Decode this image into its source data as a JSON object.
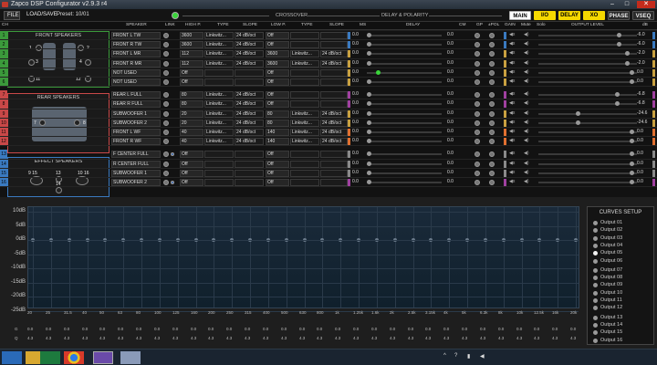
{
  "window": {
    "title": "Zapco DSP Configurator v2.9.3 r4",
    "buttons": [
      "–",
      "□",
      "✕"
    ]
  },
  "toolbar": {
    "file": "FILE",
    "load_save": "LOAD/SAVE",
    "preset": "Preset: 10/01",
    "crossover": "CROSSOVER",
    "delay_polarity": "DELAY & POLARITY",
    "tabs": [
      "MAIN",
      "I/O",
      "DELAY",
      "XO",
      "PHASE",
      "VSEQ"
    ]
  },
  "columns": {
    "ch": "CH",
    "speaker": "SPEAKER",
    "link": "LINK",
    "high_p": "HIGH P.",
    "type": "TYPE",
    "slope": "SLOPE",
    "low_p": "LOW P.",
    "type2": "TYPE",
    "slope2": "SLOPE",
    "ms": "MS",
    "delay": "DELAY",
    "cm": "CM",
    "gp": "GP",
    "pol": "±POL",
    "gain": "GAIN",
    "mute": "Mute",
    "solo": "Solo",
    "output_level": "OUTPUT LEVEL",
    "db": "dB"
  },
  "speaker_panels": {
    "front": {
      "title": "FRONT SPEAKERS",
      "nums": [
        "1",
        "2",
        "3",
        "4",
        "11",
        "12"
      ]
    },
    "rear": {
      "title": "REAR SPEAKERS",
      "nums": [
        "7",
        "8"
      ]
    },
    "effect": {
      "title": "EFFECT SPEAKERS",
      "nums": [
        "9 15",
        "13",
        "10 16",
        "14"
      ]
    }
  },
  "rows": [
    {
      "ch": "1",
      "speaker": "FRONT L TW",
      "hp": "3600",
      "htype": "Linkwitz...",
      "hslope": "24 dB/oct",
      "lp": "Off",
      "ltype": "",
      "lslope": "",
      "ms": "0.0",
      "delay": "0.0",
      "db": "-6.0"
    },
    {
      "ch": "2",
      "speaker": "FRONT R TW",
      "hp": "3600",
      "htype": "Linkwitz...",
      "hslope": "24 dB/oct",
      "lp": "Off",
      "ltype": "",
      "lslope": "",
      "ms": "0.0",
      "delay": "0.0",
      "db": "-6.0"
    },
    {
      "ch": "3",
      "speaker": "FRONT L MR",
      "hp": "112",
      "htype": "Linkwitz...",
      "hslope": "24 dB/oct",
      "lp": "3600",
      "ltype": "Linkwitz...",
      "lslope": "24 dB/oct",
      "ms": "0.0",
      "delay": "0.0",
      "db": "-2.0"
    },
    {
      "ch": "4",
      "speaker": "FRONT R MR",
      "hp": "112",
      "htype": "Linkwitz...",
      "hslope": "24 dB/oct",
      "lp": "3600",
      "ltype": "Linkwitz...",
      "lslope": "24 dB/oct",
      "ms": "0.0",
      "delay": "0.0",
      "db": "-2.0"
    },
    {
      "ch": "5",
      "speaker": "NOT USED",
      "hp": "Off",
      "htype": "",
      "hslope": "",
      "lp": "Off",
      "ltype": "",
      "lslope": "",
      "ms": "0.0",
      "delay": "0.0",
      "db": "0.0"
    },
    {
      "ch": "6",
      "speaker": "NOT USED",
      "hp": "Off",
      "htype": "",
      "hslope": "",
      "lp": "Off",
      "ltype": "",
      "lslope": "",
      "ms": "0.0",
      "delay": "0.0",
      "db": "0.0"
    },
    {
      "ch": "7",
      "speaker": "REAR L FULL",
      "hp": "80",
      "htype": "Linkwitz...",
      "hslope": "24 dB/oct",
      "lp": "Off",
      "ltype": "",
      "lslope": "",
      "ms": "0.0",
      "delay": "0.0",
      "db": "-6.8"
    },
    {
      "ch": "8",
      "speaker": "REAR R FULL",
      "hp": "80",
      "htype": "Linkwitz...",
      "hslope": "24 dB/oct",
      "lp": "Off",
      "ltype": "",
      "lslope": "",
      "ms": "0.0",
      "delay": "0.0",
      "db": "-6.8"
    },
    {
      "ch": "9",
      "speaker": "SUBWOOFER 1",
      "hp": "20",
      "htype": "Linkwitz...",
      "hslope": "24 dB/oct",
      "lp": "80",
      "ltype": "Linkwitz...",
      "lslope": "24 dB/oct",
      "ms": "0.0",
      "delay": "0.0",
      "db": "-24.6"
    },
    {
      "ch": "10",
      "speaker": "SUBWOOFER 2",
      "hp": "20",
      "htype": "Linkwitz...",
      "hslope": "24 dB/oct",
      "lp": "80",
      "ltype": "Linkwitz...",
      "lslope": "24 dB/oct",
      "ms": "0.0",
      "delay": "0.0",
      "db": "-24.6"
    },
    {
      "ch": "11",
      "speaker": "FRONT L WF",
      "hp": "40",
      "htype": "Linkwitz...",
      "hslope": "24 dB/oct",
      "lp": "140",
      "ltype": "Linkwitz...",
      "lslope": "24 dB/oct",
      "ms": "0.0",
      "delay": "0.0",
      "db": "0.0"
    },
    {
      "ch": "12",
      "speaker": "FRONT R WF",
      "hp": "40",
      "htype": "Linkwitz...",
      "hslope": "24 dB/oct",
      "lp": "140",
      "ltype": "Linkwitz...",
      "lslope": "24 dB/oct",
      "ms": "0.0",
      "delay": "0.0",
      "db": "0.0"
    },
    {
      "ch": "13",
      "speaker": "F CENTER FULL",
      "hp": "Off",
      "htype": "",
      "hslope": "",
      "lp": "Off",
      "ltype": "",
      "lslope": "",
      "ms": "0.0",
      "delay": "0.0",
      "db": "0.0"
    },
    {
      "ch": "14",
      "speaker": "R CENTER FULL",
      "hp": "Off",
      "htype": "",
      "hslope": "",
      "lp": "Off",
      "ltype": "",
      "lslope": "",
      "ms": "0.0",
      "delay": "0.0",
      "db": "0.0"
    },
    {
      "ch": "15",
      "speaker": "SUBWOOFER 1",
      "hp": "Off",
      "htype": "",
      "hslope": "",
      "lp": "Off",
      "ltype": "",
      "lslope": "",
      "ms": "0.0",
      "delay": "0.0",
      "db": "0.0"
    },
    {
      "ch": "16",
      "speaker": "SUBWOOFER 2",
      "hp": "Off",
      "htype": "",
      "hslope": "",
      "lp": "Off",
      "ltype": "",
      "lslope": "",
      "ms": "0.0",
      "delay": "0.0",
      "db": "0.0"
    }
  ],
  "row_colors": [
    "#3b9a3b",
    "#3b9a3b",
    "#3b9a3b",
    "#3b9a3b",
    "#3b9a3b",
    "#3b9a3b",
    "#c94848",
    "#c94848",
    "#c94848",
    "#c94848",
    "#c94848",
    "#c94848",
    "#3a7ac0",
    "#3a7ac0",
    "#3a7ac0",
    "#3a7ac0"
  ],
  "bar_colors": [
    "#3a7ac0",
    "#3a7ac0",
    "#c8a040",
    "#c8a040",
    "#c8a040",
    "#c8a040",
    "#a040a0",
    "#a040a0",
    "#c8a040",
    "#c8a040",
    "#e07030",
    "#e07030",
    "#8a8a8a",
    "#8a8a8a",
    "#8a8a8a",
    "#a040a0"
  ],
  "graph": {
    "y_labels": [
      "10dB",
      "5dB",
      "0dB",
      "-5dB",
      "-10dB",
      "-15dB",
      "-20dB",
      "-25dB"
    ],
    "x_labels": [
      "20",
      "25",
      "31.5",
      "40",
      "50",
      "63",
      "80",
      "100",
      "125",
      "160",
      "200",
      "250",
      "315",
      "400",
      "500",
      "630",
      "800",
      "1k",
      "1.25k",
      "1.6k",
      "2k",
      "2.5k",
      "3.15k",
      "4k",
      "5k",
      "6.3k",
      "8k",
      "10k",
      "12.5k",
      "16k",
      "20k"
    ],
    "g_label": "G",
    "q_label": "Q",
    "g_value": "0.0",
    "q_value": "4.3"
  },
  "curves_setup": {
    "title": "CURVES SETUP",
    "outputs": [
      "Output 01",
      "Output 02",
      "Output 03",
      "Output 04",
      "Output 05",
      "Output 06",
      "Output 07",
      "Output 08",
      "Output 09",
      "Output 10",
      "Output 11",
      "Output 12",
      "Output 13",
      "Output 14",
      "Output 15",
      "Output 16"
    ],
    "selected": "Output 05"
  },
  "taskbar": {
    "time": "",
    "apps": [
      "start",
      "file-explorer",
      "excel",
      "chrome",
      "dsp-app",
      "paint"
    ]
  }
}
